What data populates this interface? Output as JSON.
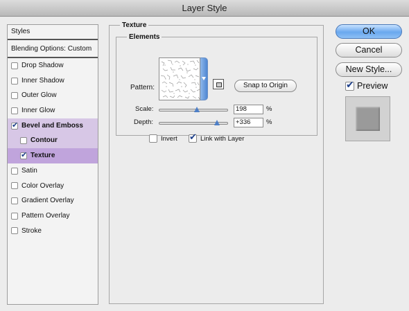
{
  "window": {
    "title": "Layer Style"
  },
  "styles_panel": {
    "header": "Styles",
    "blending_options": "Blending Options: Custom",
    "items": [
      {
        "label": "Drop Shadow",
        "checked": false
      },
      {
        "label": "Inner Shadow",
        "checked": false
      },
      {
        "label": "Outer Glow",
        "checked": false
      },
      {
        "label": "Inner Glow",
        "checked": false
      },
      {
        "label": "Bevel and Emboss",
        "checked": true
      },
      {
        "label": "Contour",
        "checked": false
      },
      {
        "label": "Texture",
        "checked": true
      },
      {
        "label": "Satin",
        "checked": false
      },
      {
        "label": "Color Overlay",
        "checked": false
      },
      {
        "label": "Gradient Overlay",
        "checked": false
      },
      {
        "label": "Pattern Overlay",
        "checked": false
      },
      {
        "label": "Stroke",
        "checked": false
      }
    ]
  },
  "texture": {
    "group_title": "Texture",
    "elements_title": "Elements",
    "pattern_label": "Pattern:",
    "snap_button": "Snap to Origin",
    "scale_label": "Scale:",
    "scale_value": "198",
    "scale_unit": "%",
    "scale_fraction": 0.55,
    "depth_label": "Depth:",
    "depth_value": "+336",
    "depth_unit": "%",
    "depth_fraction": 0.84,
    "invent_label": "Invert",
    "invert_checked": false,
    "link_label": "Link with Layer",
    "link_checked": true
  },
  "buttons": {
    "ok": "OK",
    "cancel": "Cancel",
    "new_style": "New Style...",
    "preview": "Preview",
    "preview_checked": true
  },
  "colors": {
    "selected_light": "#d7c7e6",
    "selected_dark": "#c0a4dc",
    "accent_blue": "#6aa8ee"
  }
}
